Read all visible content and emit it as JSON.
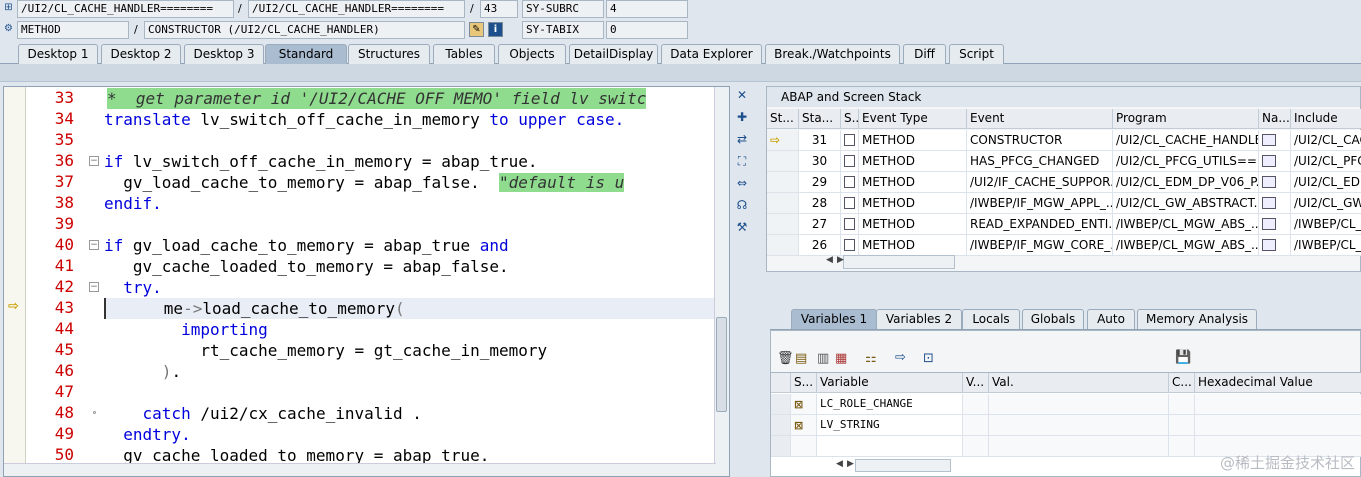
{
  "top": {
    "row1": {
      "prog1": "/UI2/CL_CACHE_HANDLER========",
      "sep1": "/",
      "prog2": "/UI2/CL_CACHE_HANDLER========",
      "sep2": "/",
      "line": "43",
      "sysfield": "SY-SUBRC",
      "sysval": "4"
    },
    "row2": {
      "type": "METHOD",
      "sep": "/",
      "method": "CONSTRUCTOR (/UI2/CL_CACHE_HANDLER)",
      "sysfield": "SY-TABIX",
      "sysval": "0"
    }
  },
  "tabs": [
    "Desktop 1",
    "Desktop 2",
    "Desktop 3",
    "Standard",
    "Structures",
    "Tables",
    "Objects",
    "DetailDisplay",
    "Data Explorer",
    "Break./Watchpoints",
    "Diff",
    "Script"
  ],
  "active_tab": "Standard",
  "editor": {
    "lines": [
      {
        "no": "33",
        "code": "*  get parameter id '/UI2/CACHE OFF MEMO' field lv switc"
      },
      {
        "no": "34",
        "code": "translate lv_switch_off_cache_in_memory to upper case."
      },
      {
        "no": "35",
        "code": ""
      },
      {
        "no": "36",
        "code": "if lv_switch_off_cache_in_memory = abap_true."
      },
      {
        "no": "37",
        "code": "  gv_load_cache_to_memory = abap_false.  \"default is u"
      },
      {
        "no": "38",
        "code": "endif."
      },
      {
        "no": "39",
        "code": ""
      },
      {
        "no": "40",
        "code": "if gv_load_cache_to_memory = abap_true and"
      },
      {
        "no": "41",
        "code": "   gv_cache_loaded_to_memory = abap_false."
      },
      {
        "no": "42",
        "code": "  try."
      },
      {
        "no": "43",
        "code": "      me->load_cache_to_memory("
      },
      {
        "no": "44",
        "code": "        importing"
      },
      {
        "no": "45",
        "code": "          rt_cache_memory = gt_cache_in_memory"
      },
      {
        "no": "46",
        "code": "      )."
      },
      {
        "no": "47",
        "code": ""
      },
      {
        "no": "48",
        "code": "    catch /ui2/cx_cache_invalid ."
      },
      {
        "no": "49",
        "code": "  endtry."
      },
      {
        "no": "50",
        "code": "  gv_cache_loaded_to_memory = abap_true."
      }
    ]
  },
  "stack": {
    "title": "ABAP and Screen Stack",
    "headers": [
      "St...",
      "Sta...",
      "S...",
      "Event Type",
      "Event",
      "Program",
      "Na...",
      "Include"
    ],
    "rows": [
      {
        "level": "31",
        "type": "METHOD",
        "event": "CONSTRUCTOR",
        "program": "/UI2/CL_CACHE_HANDLE...",
        "include": "/UI2/CL_CAC"
      },
      {
        "level": "30",
        "type": "METHOD",
        "event": "HAS_PFCG_CHANGED",
        "program": "/UI2/CL_PFCG_UTILS==...",
        "include": "/UI2/CL_PFC"
      },
      {
        "level": "29",
        "type": "METHOD",
        "event": "/UI2/IF_CACHE_SUPPOR...",
        "program": "/UI2/CL_EDM_DP_V06_P...",
        "include": "/UI2/CL_EDM"
      },
      {
        "level": "28",
        "type": "METHOD",
        "event": "/IWBEP/IF_MGW_APPL_...",
        "program": "/UI2/CL_GW_ABSTRACT...",
        "include": "/UI2/CL_GW"
      },
      {
        "level": "27",
        "type": "METHOD",
        "event": "READ_EXPANDED_ENTI...",
        "program": "/IWBEP/CL_MGW_ABS_...",
        "include": "/IWBEP/CL_"
      },
      {
        "level": "26",
        "type": "METHOD",
        "event": "/IWBEP/IF_MGW_CORE_...",
        "program": "/IWBEP/CL_MGW_ABS_...",
        "include": "/IWBEP/CL_I"
      }
    ]
  },
  "var_tabs": [
    "Variables 1",
    "Variables 2",
    "Locals",
    "Globals",
    "Auto",
    "Memory Analysis"
  ],
  "variables": {
    "headers": [
      "S...",
      "Variable",
      "V...",
      "Val.",
      "C...",
      "Hexadecimal Value"
    ],
    "rows": [
      {
        "name": "LC_ROLE_CHANGE"
      },
      {
        "name": "LV_STRING"
      }
    ]
  },
  "watermark": "@稀土掘金技术社区"
}
